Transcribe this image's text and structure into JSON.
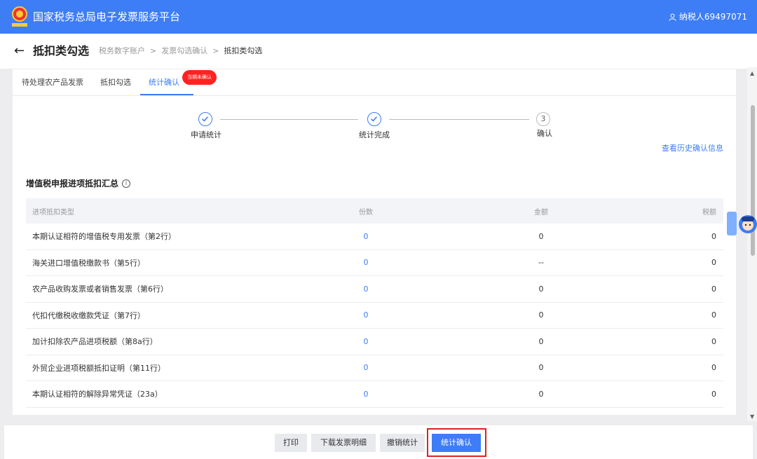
{
  "header": {
    "app_title": "国家税务总局电子发票服务平台",
    "user_label": "纳税人69497071"
  },
  "subheader": {
    "page_title": "抵扣类勾选",
    "breadcrumb": [
      "税务数字账户",
      "发票勾选确认",
      "抵扣类勾选"
    ],
    "separator": ">"
  },
  "tabs": [
    {
      "label": "待处理农产品发票"
    },
    {
      "label": "抵扣勾选"
    },
    {
      "label": "统计确认"
    }
  ],
  "tab_badge": "当期未确认",
  "steps": [
    {
      "label": "申请统计",
      "status": "done"
    },
    {
      "label": "统计完成",
      "status": "done"
    },
    {
      "label": "确认",
      "status": "current",
      "number": "3"
    }
  ],
  "history_link": "查看历史确认信息",
  "section_title": "增值税申报进项抵扣汇总",
  "table": {
    "columns": [
      "进项抵扣类型",
      "份数",
      "金额",
      "税额"
    ],
    "rows": [
      {
        "type": "本期认证相符的增值税专用发票（第2行）",
        "count": "0",
        "amount": "0",
        "tax": "0"
      },
      {
        "type": "海关进口增值税缴款书（第5行）",
        "count": "0",
        "amount": "--",
        "tax": "0"
      },
      {
        "type": "农产品收购发票或者销售发票（第6行）",
        "count": "0",
        "amount": "0",
        "tax": "0"
      },
      {
        "type": "代扣代缴税收缴款凭证（第7行）",
        "count": "0",
        "amount": "0",
        "tax": "0"
      },
      {
        "type": "加计扣除农产品进项税额（第8a行）",
        "count": "0",
        "amount": "0",
        "tax": "0"
      },
      {
        "type": "外贸企业进项税额抵扣证明（第11行）",
        "count": "0",
        "amount": "0",
        "tax": "0"
      },
      {
        "type": "本期认证相符的解除异常凭证（23a）",
        "count": "0",
        "amount": "0",
        "tax": "0"
      }
    ]
  },
  "actions": {
    "print": "打印",
    "download": "下载发票明细",
    "cancel_stats": "撤销统计",
    "confirm_stats": "统计确认"
  },
  "colors": {
    "primary": "#3d7df5",
    "badge": "#ff2222",
    "highlight": "#e02020"
  },
  "icons": {
    "back": "arrow-left-icon",
    "user": "user-icon",
    "info": "info-circle-icon",
    "check": "check-circle-icon",
    "assistant": "assistant-avatar-icon"
  }
}
